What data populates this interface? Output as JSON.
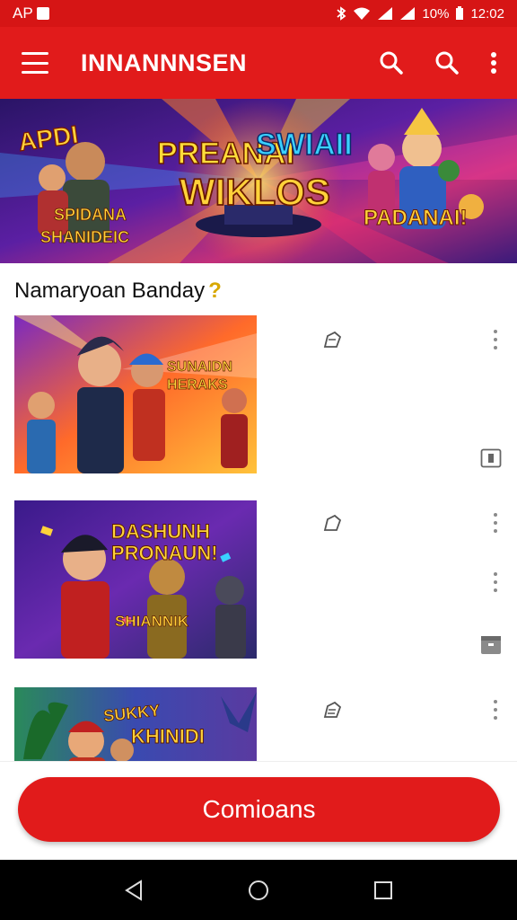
{
  "status_bar": {
    "carrier": "AP",
    "battery": "10%",
    "time": "12:02"
  },
  "app_bar": {
    "title": "INNANNNSEN"
  },
  "banner": {
    "left_text_1": "APDI",
    "left_text_2": "SPIDANA",
    "left_text_3": "SHANIDEIC",
    "center_text_1": "PREANAI",
    "center_text_2": "SWIAII",
    "center_text_3": "WIKLOS",
    "right_text": "PADANAI!"
  },
  "section": {
    "title": "Namaryoan Banday",
    "title_mark": "?"
  },
  "items": [
    {
      "thumb_text_1": "SUNAIDN",
      "thumb_text_2": "HERAKS"
    },
    {
      "thumb_text_1": "DASHUNH",
      "thumb_text_2": "PRONAUN!",
      "thumb_text_3": "SHIANNIK"
    },
    {
      "thumb_text_1": "SUKKY",
      "thumb_text_2": "KHINIDI"
    }
  ],
  "cta": {
    "label": "Comioans"
  },
  "colors": {
    "primary_red": "#e11b1b",
    "status_red": "#d61515",
    "accent_gold": "#d8a800"
  }
}
